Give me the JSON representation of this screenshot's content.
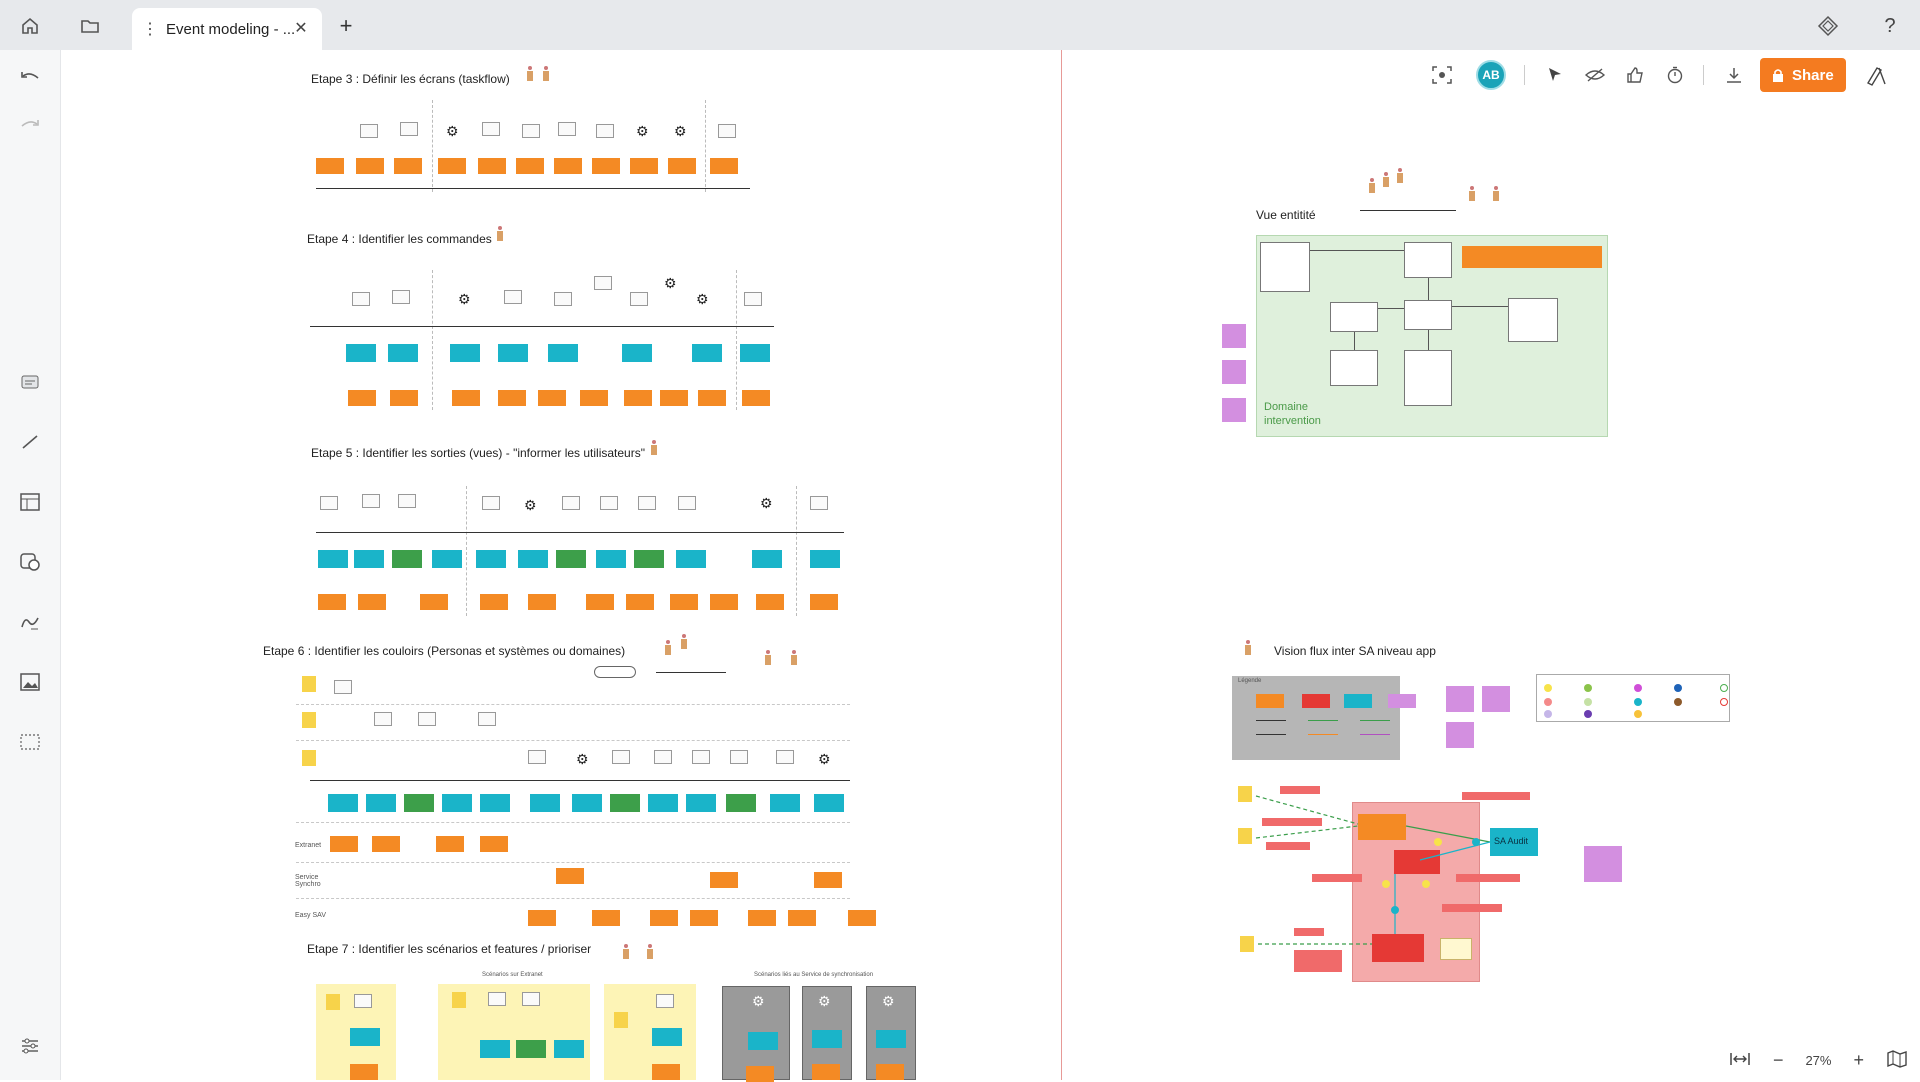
{
  "tab": {
    "title": "Event modeling - ..."
  },
  "toolbar": {
    "avatar_initials": "AB",
    "share_label": "Share"
  },
  "zoom": {
    "level": "27%"
  },
  "board": {
    "step3": "Etape 3 : Définir les écrans (taskflow)",
    "step4": "Etape 4 : Identifier les commandes",
    "step5": "Etape 5 : Identifier les sorties (vues) - \"informer les utilisateurs\"",
    "step6": "Etape 6 : Identifier les couloirs (Personas et systèmes ou domaines)",
    "step7": "Etape 7 : Identifier les scénarios et features / prioriser",
    "entity_view": "Vue entitité",
    "domain_label": "Domaine\nintervention",
    "flux_view": "Vision flux inter SA niveau app",
    "legend_title": "Légende",
    "lane_extranet": "Extranet",
    "lane_service": "Service\nSynchro",
    "lane_easysav": "Easy SAV",
    "scenarios_extranet": "Scénarios sur Extranet",
    "scenarios_sync": "Scénarios liés au Service de synchronisation",
    "sa_audit": "SA Audit"
  }
}
